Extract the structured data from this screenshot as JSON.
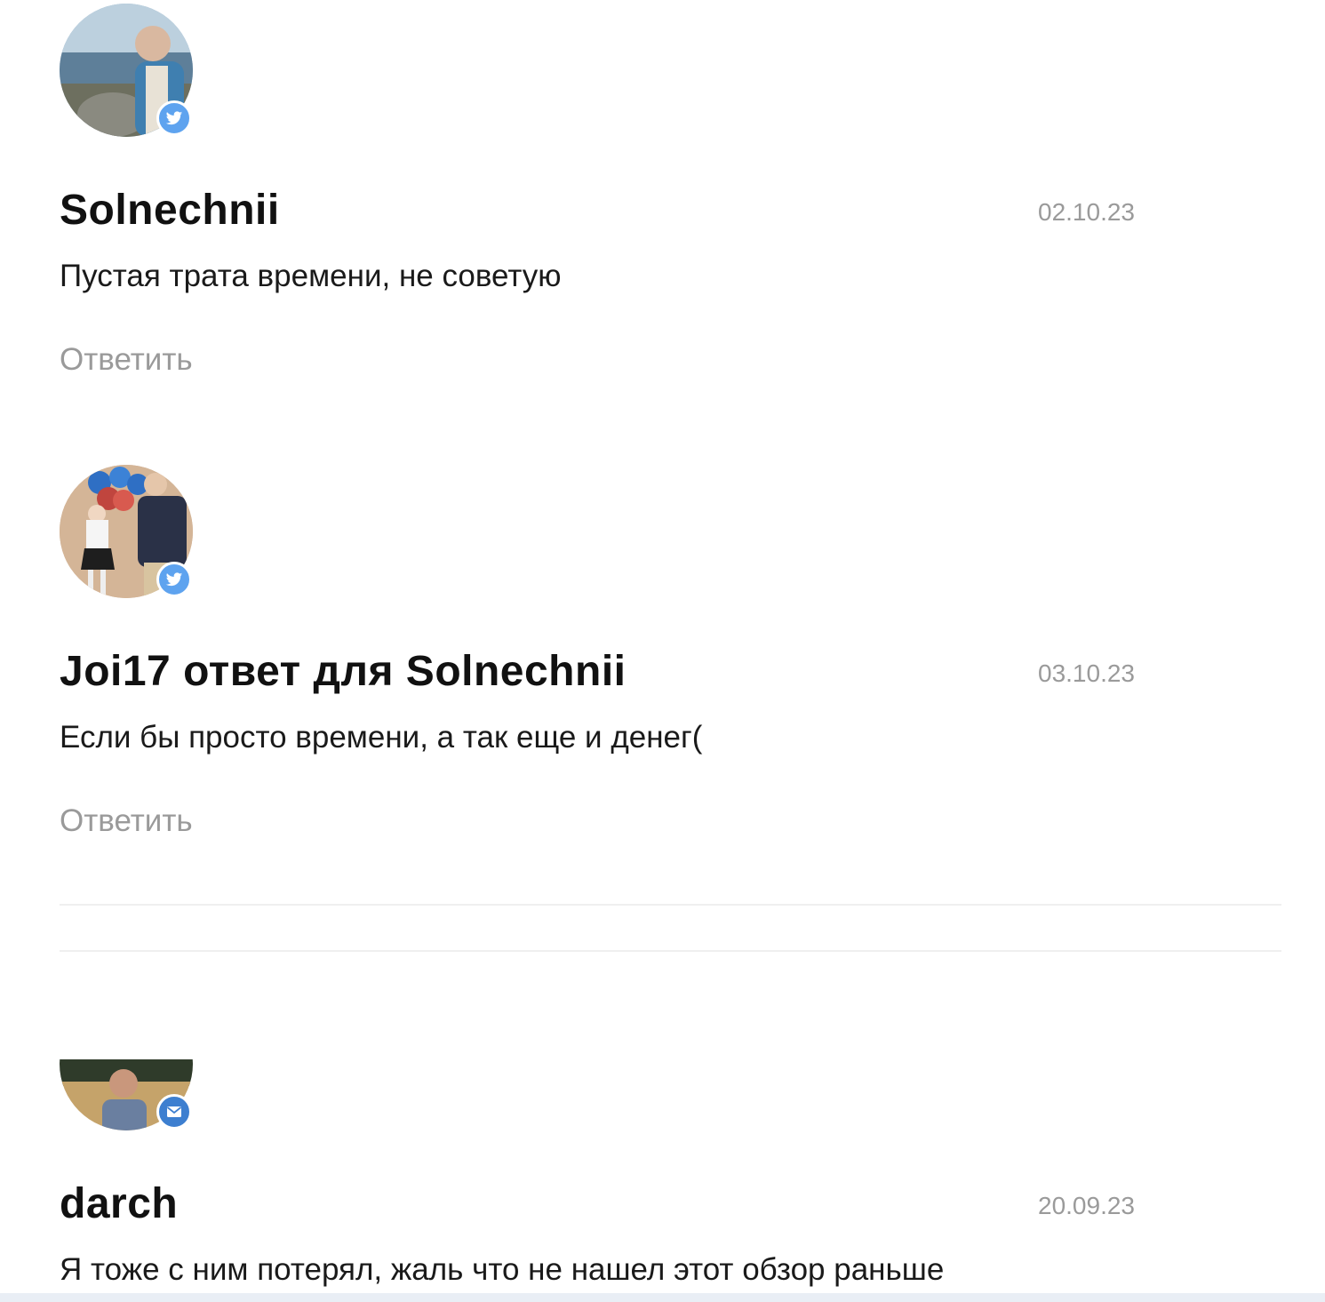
{
  "comments": [
    {
      "author": "Solnechnii",
      "date": "02.10.23",
      "text": "Пустая трата времени, не советую",
      "reply_label": "Ответить",
      "avatar_icon": "user-photo-avatar",
      "badge_icon": "twitter-icon"
    },
    {
      "author": "Joi17 ответ для Solnechnii",
      "date": "03.10.23",
      "text": "Если бы просто времени, а так еще и денег(",
      "reply_label": "Ответить",
      "avatar_icon": "user-photo-avatar",
      "badge_icon": "twitter-icon"
    },
    {
      "author": "darch",
      "date": "20.09.23",
      "text": "Я тоже с ним потерял, жаль что не нашел этот обзор раньше",
      "avatar_icon": "user-photo-avatar",
      "badge_icon": "mail-icon"
    }
  ],
  "colors": {
    "author": "#111111",
    "meta": "#9a9a9a",
    "twitter_badge": "#5ea3ef",
    "mail_badge": "#3d7fd0"
  }
}
